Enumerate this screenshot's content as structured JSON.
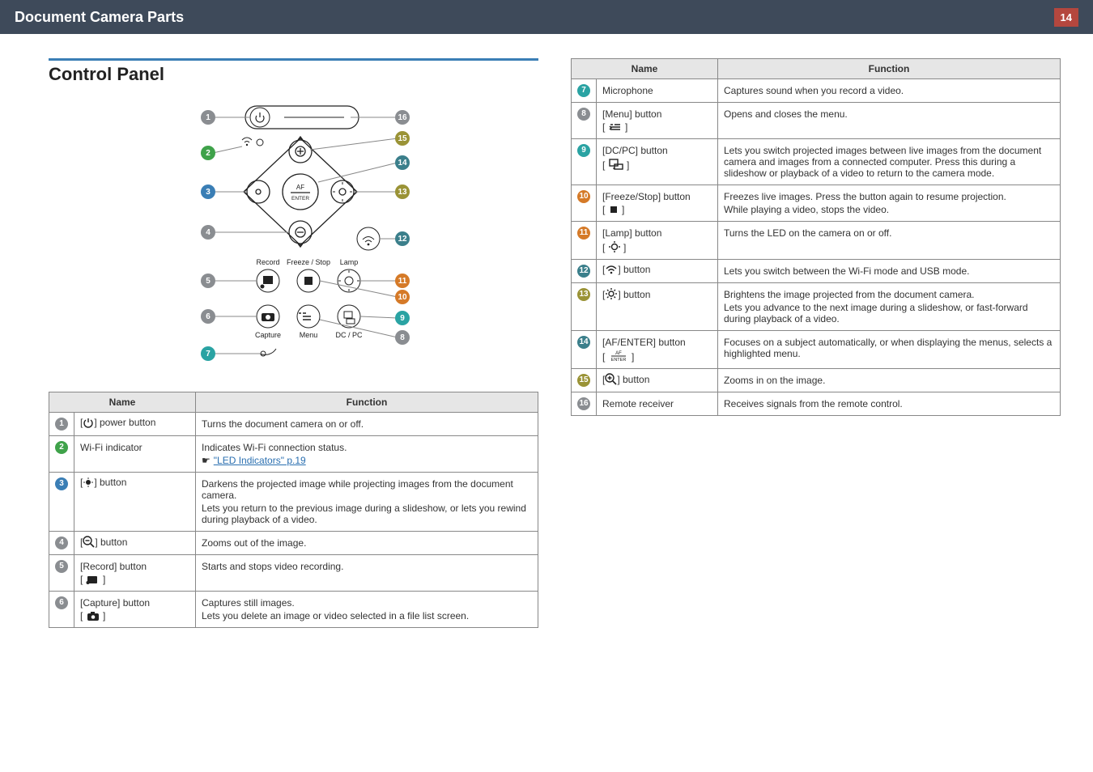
{
  "header": {
    "title": "Document Camera Parts",
    "page": "14"
  },
  "section_title": "Control  Panel",
  "diagram_labels": {
    "record": "Record",
    "freeze": "Freeze / Stop",
    "lamp": "Lamp",
    "capture": "Capture",
    "menu": "Menu",
    "dcpc": "DC / PC",
    "af_enter": "AF\nENTER"
  },
  "link_text": "\"LED Indicators\" p.19",
  "table_headers": {
    "name": "Name",
    "function": "Function"
  },
  "items": [
    {
      "num": "1",
      "badge": "nb-gray",
      "name_pre": "[",
      "name_icon": "power",
      "name_post": "] power button",
      "lines": [
        "Turns the document camera on or off."
      ]
    },
    {
      "num": "2",
      "badge": "nb-green",
      "name_text": "Wi-Fi indicator",
      "lines": [
        "Indicates Wi-Fi connection status.",
        "<link>"
      ]
    },
    {
      "num": "3",
      "badge": "nb-blue",
      "name_pre": "[",
      "name_icon": "sun-dim",
      "name_post": "] button",
      "lines": [
        "Darkens the projected image while projecting images from the document camera.",
        "Lets you return to the previous image during a slideshow, or lets you rewind during playback of a video."
      ]
    },
    {
      "num": "4",
      "badge": "nb-gray",
      "name_pre": "[",
      "name_icon": "zoom-out",
      "name_post": "] button",
      "lines": [
        "Zooms out of the image."
      ]
    },
    {
      "num": "5",
      "badge": "nb-gray",
      "name_text": "[Record] button",
      "sub_icon": "record",
      "lines": [
        "Starts and stops video recording."
      ]
    },
    {
      "num": "6",
      "badge": "nb-gray",
      "name_text": "[Capture] button",
      "sub_icon": "capture",
      "lines": [
        "Captures still images.",
        "Lets you delete an image or video selected in a file list screen."
      ]
    },
    {
      "num": "7",
      "badge": "nb-teal",
      "name_text": "Microphone",
      "lines": [
        "Captures sound when you record a video."
      ]
    },
    {
      "num": "8",
      "badge": "nb-gray",
      "name_text": "[Menu] button",
      "sub_icon": "menu",
      "lines": [
        "Opens and closes the menu."
      ]
    },
    {
      "num": "9",
      "badge": "nb-teal",
      "name_text": "[DC/PC] button",
      "sub_icon": "dcpc",
      "lines": [
        "Lets you switch projected images between live images from the document camera and images from a connected computer. Press this during a slideshow or playback of a video to return to the camera mode."
      ]
    },
    {
      "num": "10",
      "badge": "nb-org",
      "name_text": "[Freeze/Stop] button",
      "sub_icon": "freeze",
      "lines": [
        "Freezes live images. Press the button again to resume projection.",
        "While playing a video, stops the video."
      ]
    },
    {
      "num": "11",
      "badge": "nb-org",
      "name_text": "[Lamp] button",
      "sub_icon": "lamp",
      "lines": [
        "Turns the LED on the camera on or off."
      ]
    },
    {
      "num": "12",
      "badge": "nb-darkt",
      "name_pre": "[",
      "name_icon": "wifi",
      "name_post": "] button",
      "lines": [
        "Lets you switch between the Wi-Fi mode and USB mode."
      ]
    },
    {
      "num": "13",
      "badge": "nb-olive",
      "name_pre": "[",
      "name_icon": "sun-bright",
      "name_post": "] button",
      "lines": [
        "Brightens the image projected from the document camera.",
        "Lets you advance to the next image during a slideshow, or fast-forward during playback of a video."
      ]
    },
    {
      "num": "14",
      "badge": "nb-darkt",
      "name_text": "[AF/ENTER] button",
      "sub_icon": "af-enter",
      "lines": [
        "Focuses on a subject automatically, or when displaying the menus, selects a highlighted menu."
      ]
    },
    {
      "num": "15",
      "badge": "nb-olive",
      "name_pre": "[",
      "name_icon": "zoom-in",
      "name_post": "] button",
      "lines": [
        "Zooms in on the image."
      ]
    },
    {
      "num": "16",
      "badge": "nb-gray",
      "name_text": "Remote receiver",
      "lines": [
        "Receives signals from the remote control."
      ]
    }
  ]
}
